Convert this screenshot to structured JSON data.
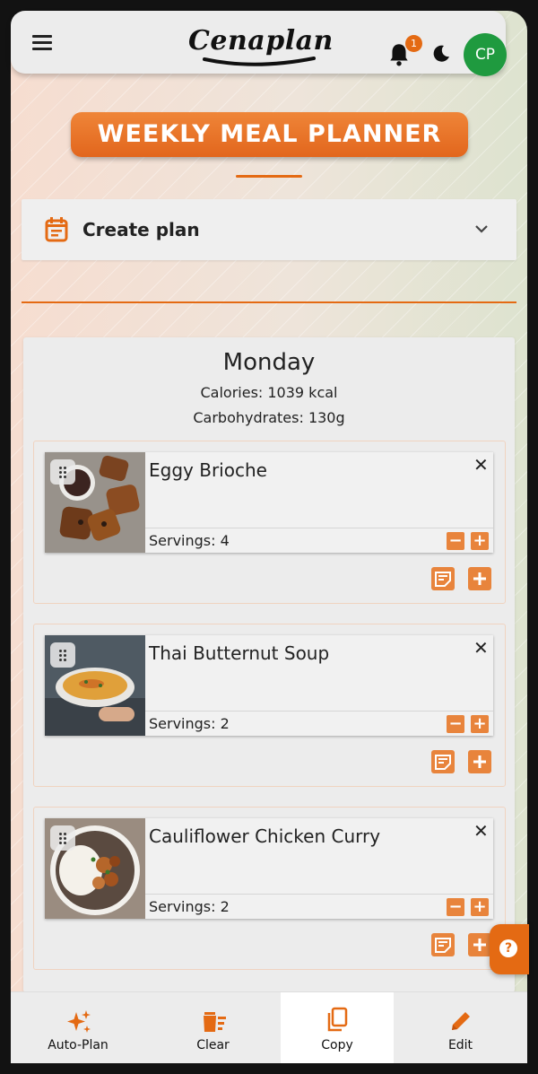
{
  "app": {
    "logo_text": "Cenaplan",
    "notification_count": "1",
    "avatar_initials": "CP"
  },
  "banner": {
    "title": "WEEKLY MEAL PLANNER"
  },
  "create_plan": {
    "label": "Create plan"
  },
  "day": {
    "name": "Monday",
    "calories": "Calories: 1039 kcal",
    "carbs": "Carbohydrates: 130g"
  },
  "meals": [
    {
      "title": "Eggy Brioche",
      "servings": "Servings: 4"
    },
    {
      "title": "Thai Butternut Soup",
      "servings": "Servings: 2"
    },
    {
      "title": "Cauliflower Chicken Curry",
      "servings": "Servings: 2"
    }
  ],
  "symbols": {
    "close": "✕",
    "minus": "−",
    "plus": "+",
    "help": "?"
  },
  "bottom_nav": [
    {
      "label": "Auto-Plan",
      "icon": "sparkle-icon"
    },
    {
      "label": "Clear",
      "icon": "clear-list-icon"
    },
    {
      "label": "Copy",
      "icon": "copy-icon",
      "active": true
    },
    {
      "label": "Edit",
      "icon": "pencil-icon"
    }
  ],
  "colors": {
    "accent": "#e46a13",
    "avatar": "#1f9a3f",
    "card": "#ececec"
  }
}
